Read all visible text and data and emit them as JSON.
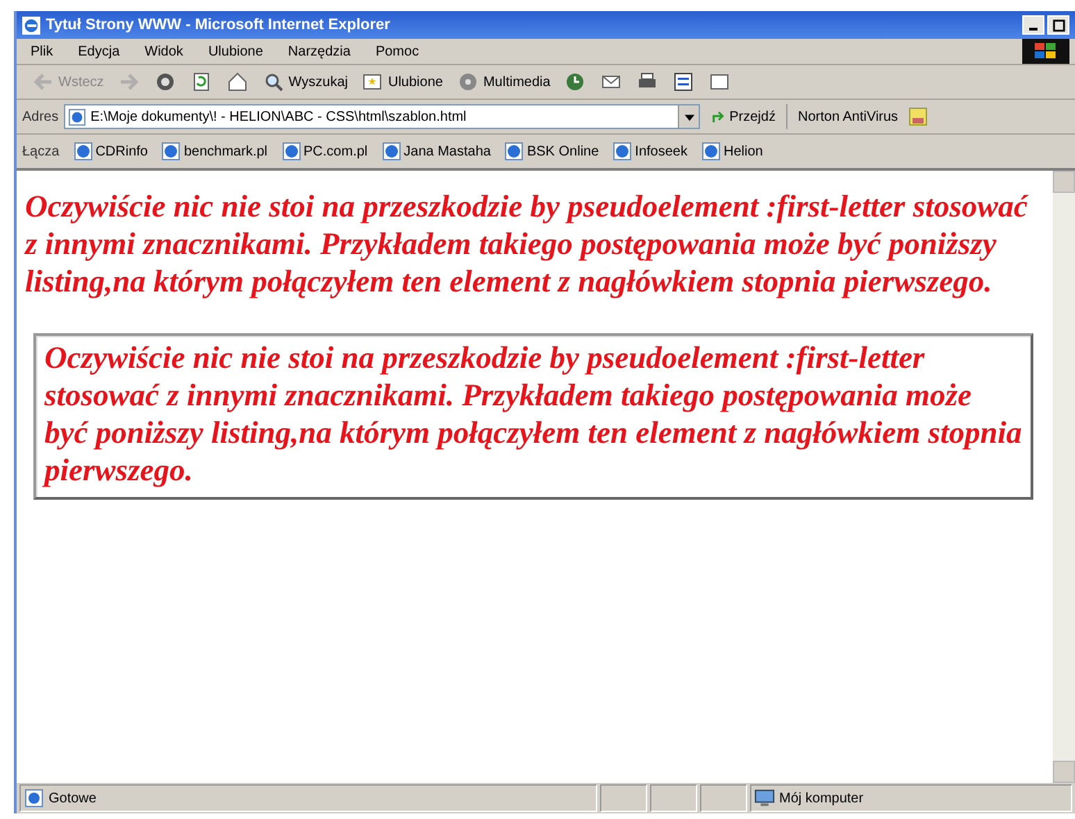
{
  "window": {
    "title": "Tytuł Strony WWW - Microsoft Internet Explorer"
  },
  "menu": [
    {
      "label": "Plik"
    },
    {
      "label": "Edycja"
    },
    {
      "label": "Widok"
    },
    {
      "label": "Ulubione"
    },
    {
      "label": "Narzędzia"
    },
    {
      "label": "Pomoc"
    }
  ],
  "toolbar": [
    {
      "kind": "back",
      "label": "Wstecz",
      "disabled": true
    },
    {
      "kind": "forward",
      "disabled": true
    },
    {
      "kind": "stop",
      "disabled": false
    },
    {
      "kind": "refresh",
      "disabled": false
    },
    {
      "kind": "home",
      "disabled": false
    },
    {
      "kind": "search",
      "label": "Wyszukaj",
      "disabled": false
    },
    {
      "kind": "favorites",
      "label": "Ulubione",
      "disabled": false
    },
    {
      "kind": "media",
      "label": "Multimedia",
      "disabled": false
    },
    {
      "kind": "history",
      "disabled": false
    },
    {
      "kind": "mail",
      "disabled": false
    },
    {
      "kind": "print",
      "disabled": false
    },
    {
      "kind": "edit",
      "disabled": false
    },
    {
      "kind": "discuss",
      "disabled": false
    }
  ],
  "address": {
    "label": "Adres",
    "value": "E:\\Moje dokumenty\\! - HELION\\ABC - CSS\\html\\szablon.html",
    "go": "Przejdź",
    "addon": "Norton AntiVirus"
  },
  "links": {
    "label": "Łącza",
    "items": [
      "CDRinfo",
      "benchmark.pl",
      "PC.com.pl",
      "Jana Mastaha",
      "BSK Online",
      "Infoseek",
      "Helion"
    ]
  },
  "content": {
    "heading": "Oczywiście nic nie stoi na przeszkodzie by pseudoelement :first-letter stosować z innymi znacznikami. Przykładem takiego postępowania może być poniższy listing,na którym połączyłem ten element z nagłówkiem stopnia pierwszego.",
    "boxed": "Oczywiście nic nie stoi na przeszkodzie by pseudoelement :first-letter stosować z innymi znacznikami. Przykładem takiego postępowania może być poniższy listing,na którym połączyłem ten element z nagłówkiem stopnia pierwszego."
  },
  "status_bar": {
    "status": "Gotowe",
    "zone": "Mój komputer"
  }
}
